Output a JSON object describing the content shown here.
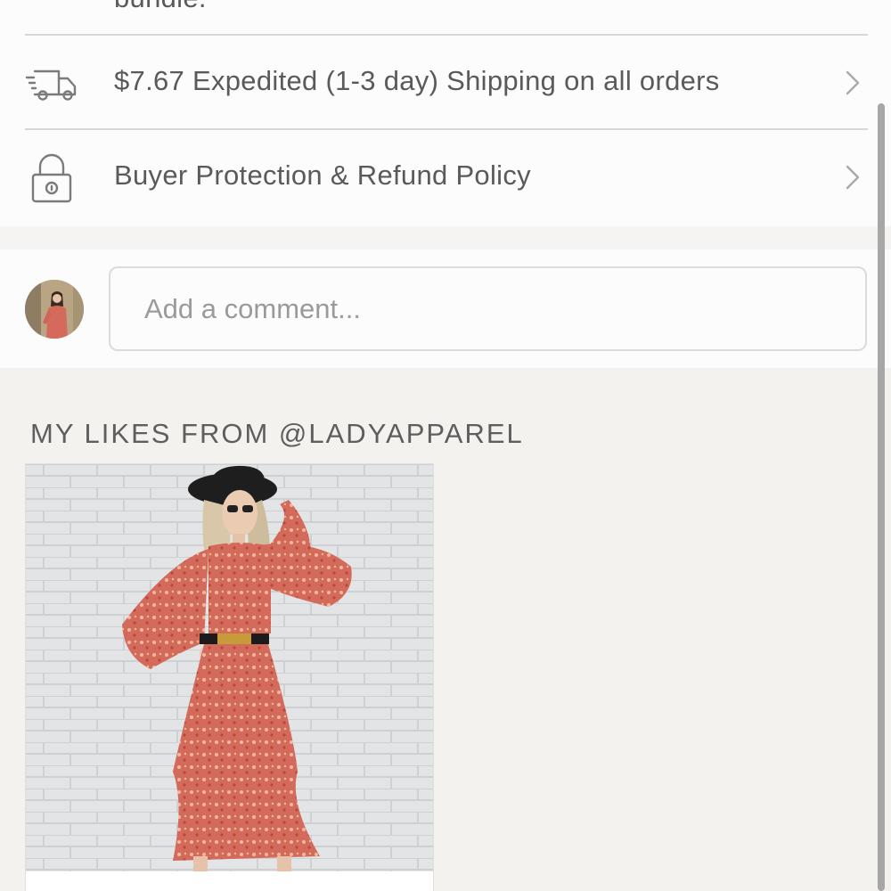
{
  "top": {
    "partial_text": "bundle."
  },
  "info_rows": [
    {
      "icon": "truck-icon",
      "label": "$7.67 Expedited (1-3 day) Shipping on all orders"
    },
    {
      "icon": "lock-icon",
      "label": "Buyer Protection & Refund Policy"
    }
  ],
  "comment": {
    "placeholder": "Add a comment..."
  },
  "likes": {
    "title": "MY LIKES FROM @LADYAPPAREL",
    "items": [
      {
        "image": "floral-midi-dress-photo",
        "caption": ""
      }
    ]
  },
  "colors": {
    "text": "#5a5a5a",
    "divider": "#d8d6d6",
    "likes_background": "#f4f2ef",
    "dress": "#d46a5c"
  }
}
